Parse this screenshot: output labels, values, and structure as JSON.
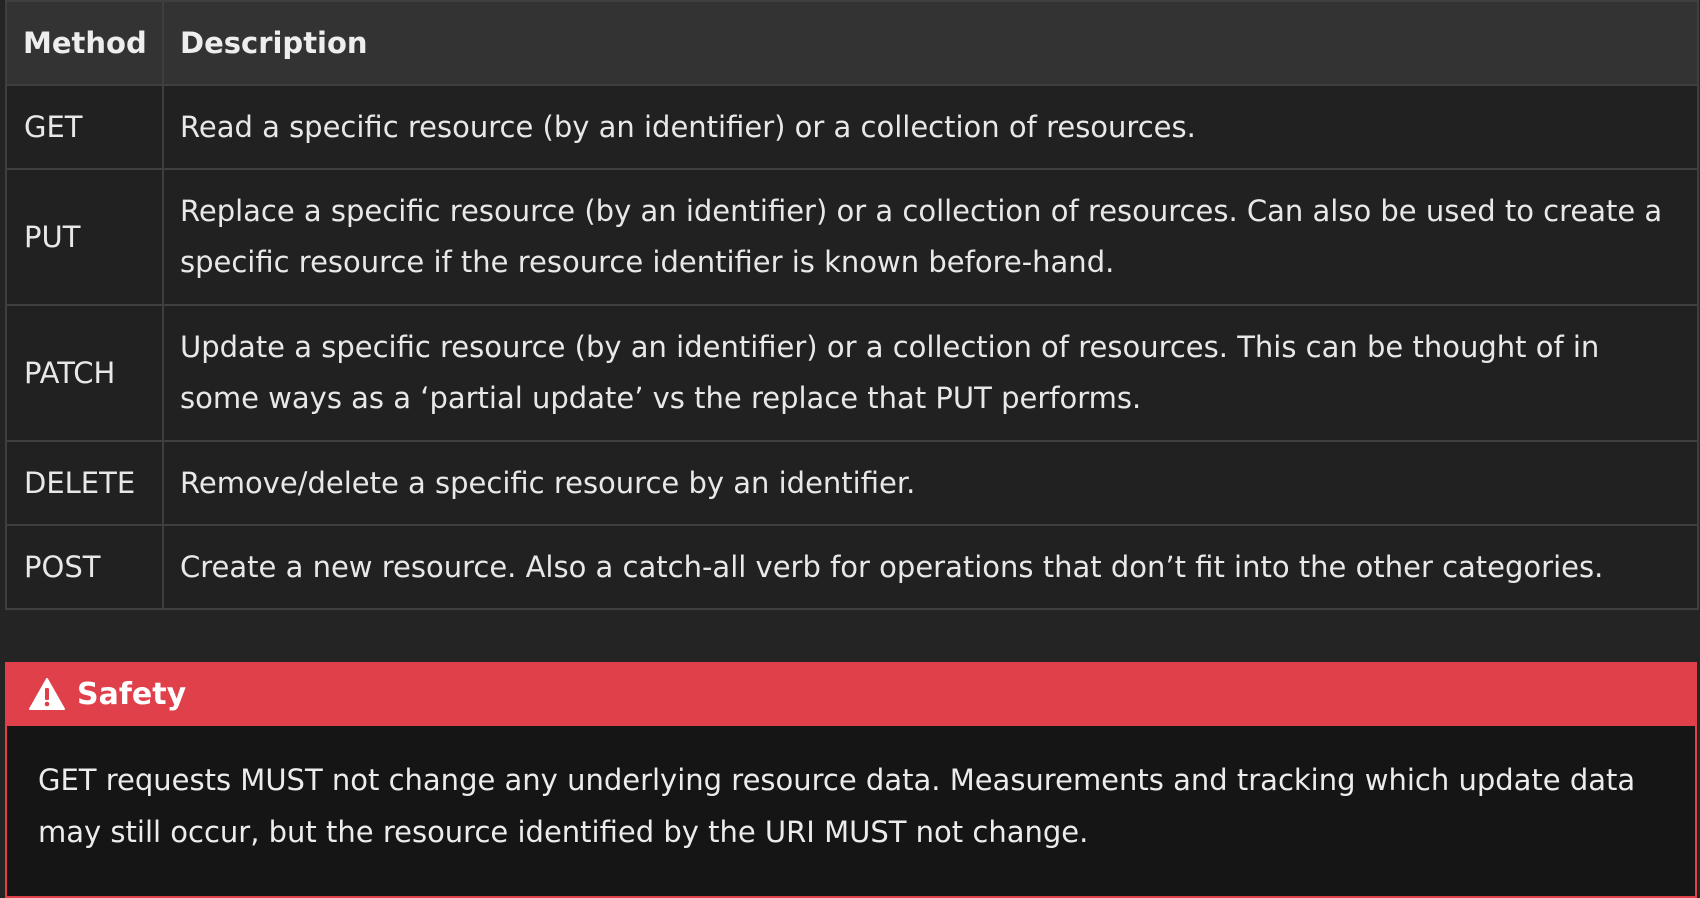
{
  "table": {
    "headers": [
      "Method",
      "Description"
    ],
    "rows": [
      {
        "method": "GET",
        "description": "Read a specific resource (by an identifier) or a collection of resources."
      },
      {
        "method": "PUT",
        "description": "Replace a specific resource (by an identifier) or a collection of resources. Can also be used to create a specific resource if the resource identifier is known before-hand."
      },
      {
        "method": "PATCH",
        "description": "Update a specific resource (by an identifier) or a collection of resources. This can be thought of in some ways as a ‘partial update’ vs the replace that PUT performs."
      },
      {
        "method": "DELETE",
        "description": "Remove/delete a specific resource by an identifier."
      },
      {
        "method": "POST",
        "description": "Create a new resource. Also a catch-all verb for operations that don’t fit into the other categories."
      }
    ]
  },
  "callout": {
    "icon": "warning-icon",
    "title": "Safety",
    "body": "GET requests MUST not change any underlying resource data. Measurements and tracking which update data may still occur, but the resource identified by the URI MUST not change.",
    "accent_color": "#e0404a"
  },
  "colors": {
    "page_background": "#242424",
    "header_background": "#333333",
    "cell_background": "#212121",
    "border": "#3f3f3f",
    "callout_body_background": "#151515"
  }
}
